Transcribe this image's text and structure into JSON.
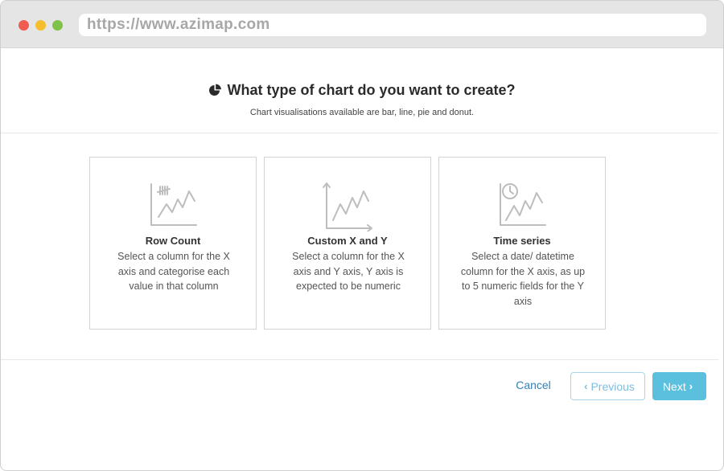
{
  "browser": {
    "url": "https://www.azimap.com"
  },
  "header": {
    "icon": "pie-chart-icon",
    "title": "What type of chart do you want to create?",
    "subtitle": "Chart visualisations available are bar, line, pie and donut."
  },
  "cards": [
    {
      "icon": "row-count-chart-icon",
      "title": "Row Count",
      "description": "Select a column for the X axis and categorise each value in that column"
    },
    {
      "icon": "xy-axis-chart-icon",
      "title": "Custom X and Y",
      "description": "Select a column for the X axis and Y axis, Y axis is expected to be numeric"
    },
    {
      "icon": "time-series-chart-icon",
      "title": "Time series",
      "description": "Select a date/ datetime column for the X axis, as up to 5 numeric fields for the Y axis"
    }
  ],
  "footer": {
    "cancel_label": "Cancel",
    "previous_label": "Previous",
    "next_label": "Next"
  },
  "colors": {
    "accent": "#5bc0de",
    "link": "#2e83b9",
    "close_dot": "#f05b52",
    "minimize_dot": "#f4be2f",
    "maximize_dot": "#7fc24a"
  }
}
